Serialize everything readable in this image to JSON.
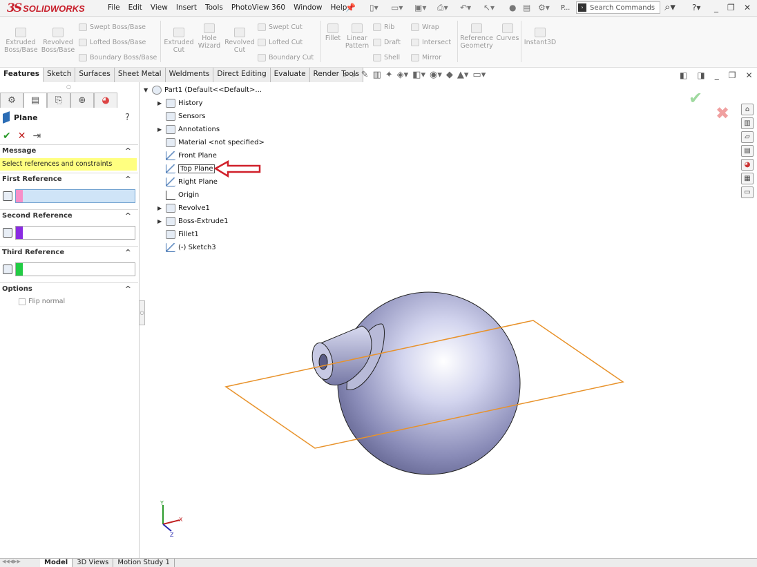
{
  "app": {
    "logo_ds": "3S",
    "logo_name": "SOLIDWORKS"
  },
  "menu": [
    "File",
    "Edit",
    "View",
    "Insert",
    "Tools",
    "PhotoView 360",
    "Window",
    "Help"
  ],
  "search": {
    "placeholder": "Search Commands",
    "prefix": "P..."
  },
  "ribbon": {
    "extruded_boss": "Extruded Boss/Base",
    "revolved_boss": "Revolved Boss/Base",
    "swept_boss": "Swept Boss/Base",
    "lofted_boss": "Lofted Boss/Base",
    "boundary_boss": "Boundary Boss/Base",
    "extruded_cut": "Extruded Cut",
    "hole_wizard": "Hole Wizard",
    "revolved_cut": "Revolved Cut",
    "swept_cut": "Swept Cut",
    "lofted_cut": "Lofted Cut",
    "boundary_cut": "Boundary Cut",
    "fillet": "Fillet",
    "linear_pattern": "Linear Pattern",
    "rib": "Rib",
    "draft": "Draft",
    "shell": "Shell",
    "wrap": "Wrap",
    "intersect": "Intersect",
    "mirror": "Mirror",
    "reference_geometry": "Reference Geometry",
    "curves": "Curves",
    "instant3d": "Instant3D"
  },
  "tabs": [
    "Features",
    "Sketch",
    "Surfaces",
    "Sheet Metal",
    "Weldments",
    "Direct Editing",
    "Evaluate",
    "Render Tools"
  ],
  "property_manager": {
    "title": "Plane",
    "help": "?",
    "message_header": "Message",
    "message": "Select references and constraints",
    "first_ref": "First Reference",
    "second_ref": "Second Reference",
    "third_ref": "Third Reference",
    "options": "Options",
    "flip_normal": "Flip normal",
    "colors": {
      "first": "#f78fc8",
      "second": "#8a2be2",
      "third": "#22cc44"
    }
  },
  "tree": [
    {
      "label": "Part1  (Default<<Default>..."
    },
    {
      "label": "History"
    },
    {
      "label": "Sensors"
    },
    {
      "label": "Annotations"
    },
    {
      "label": "Material <not specified>"
    },
    {
      "label": "Front Plane"
    },
    {
      "label": "Top Plane"
    },
    {
      "label": "Right Plane"
    },
    {
      "label": "Origin"
    },
    {
      "label": "Revolve1"
    },
    {
      "label": "Boss-Extrude1"
    },
    {
      "label": "Fillet1"
    },
    {
      "label": "(-) Sketch3"
    }
  ],
  "bottom_tabs": [
    "Model",
    "3D Views",
    "Motion Study 1"
  ],
  "accent": {
    "plane": "#e8922a",
    "arrow": "#d0202a"
  }
}
